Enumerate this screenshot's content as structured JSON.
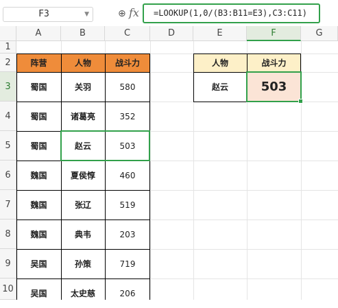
{
  "formula_bar": {
    "name_box": "F3",
    "fx_label": "fx",
    "formula": "=LOOKUP(1,0/(B3:B11=E3),C3:C11)"
  },
  "columns": [
    "A",
    "B",
    "C",
    "D",
    "E",
    "F",
    "G"
  ],
  "rows": [
    "1",
    "2",
    "3",
    "4",
    "5",
    "6",
    "7",
    "8",
    "9",
    "10"
  ],
  "active_cell": "F3",
  "table1": {
    "headers": [
      "阵营",
      "人物",
      "战斗力"
    ],
    "rows": [
      [
        "蜀国",
        "关羽",
        "580"
      ],
      [
        "蜀国",
        "诸葛亮",
        "352"
      ],
      [
        "蜀国",
        "赵云",
        "503"
      ],
      [
        "魏国",
        "夏侯惇",
        "460"
      ],
      [
        "魏国",
        "张辽",
        "519"
      ],
      [
        "魏国",
        "典韦",
        "203"
      ],
      [
        "吴国",
        "孙策",
        "719"
      ],
      [
        "吴国",
        "太史慈",
        "206"
      ]
    ]
  },
  "table2": {
    "headers": [
      "人物",
      "战斗力"
    ],
    "lookup": "赵云",
    "result": "503"
  },
  "colors": {
    "accent": "#31a04a",
    "header_orange": "#ef8c3a",
    "header_yellow": "#fdf0c8",
    "result_fill": "#fbe4d6"
  }
}
